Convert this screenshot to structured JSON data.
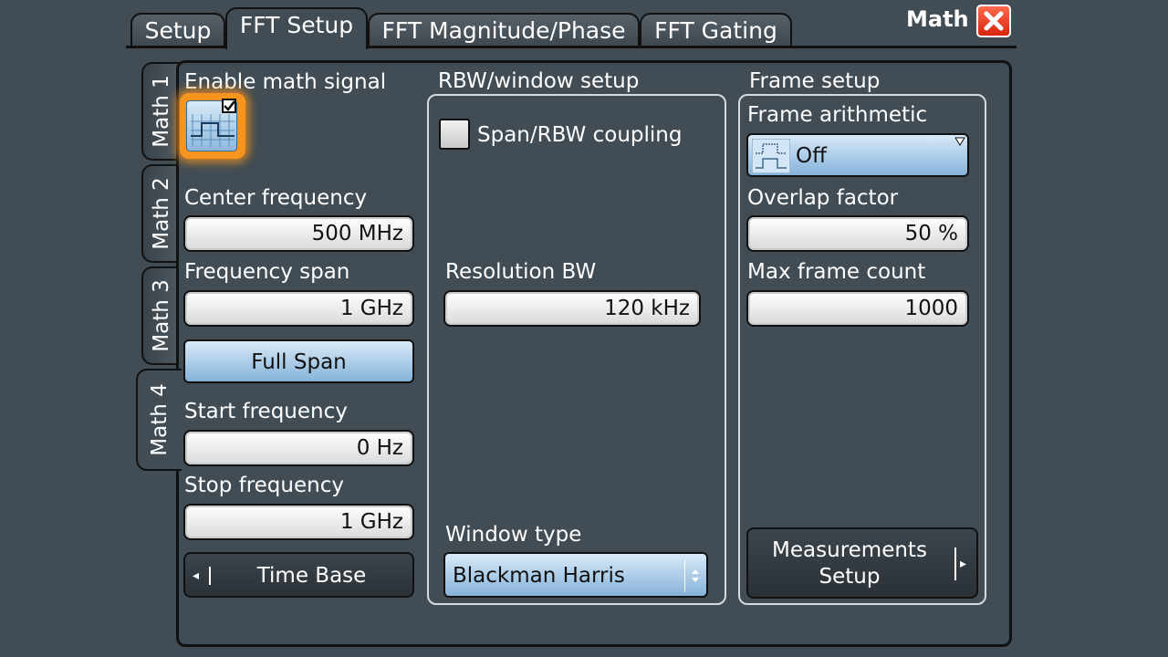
{
  "window": {
    "title": "Math"
  },
  "top_tabs": [
    {
      "label": "Setup"
    },
    {
      "label": "FFT Setup"
    },
    {
      "label": "FFT Magnitude/Phase"
    },
    {
      "label": "FFT Gating"
    }
  ],
  "side_tabs": [
    {
      "label": "Math 1"
    },
    {
      "label": "Math 2"
    },
    {
      "label": "Math 3"
    },
    {
      "label": "Math 4"
    }
  ],
  "left": {
    "enable_label": "Enable math signal",
    "center_frequency": {
      "label": "Center frequency",
      "value": "500 MHz"
    },
    "frequency_span": {
      "label": "Frequency span",
      "value": "1 GHz"
    },
    "full_span_label": "Full Span",
    "start_frequency": {
      "label": "Start frequency",
      "value": "0 Hz"
    },
    "stop_frequency": {
      "label": "Stop frequency",
      "value": "1 GHz"
    },
    "time_base_label": "Time Base"
  },
  "rbw": {
    "title": "RBW/window setup",
    "coupling_label": "Span/RBW coupling",
    "resolution_bw": {
      "label": "Resolution BW",
      "value": "120 kHz"
    },
    "window_type": {
      "label": "Window type",
      "value": "Blackman Harris"
    }
  },
  "frame": {
    "title": "Frame setup",
    "arithmetic": {
      "label": "Frame arithmetic",
      "value": "Off"
    },
    "overlap": {
      "label": "Overlap factor",
      "value": "50 %"
    },
    "max_frame": {
      "label": "Max frame count",
      "value": "1000"
    },
    "measurements_line1": "Measurements",
    "measurements_line2": "Setup"
  },
  "colors": {
    "background": "#414c54",
    "highlight": "#f7941d",
    "accent_blue": "#85b2d9",
    "close_red": "#d7240b"
  }
}
